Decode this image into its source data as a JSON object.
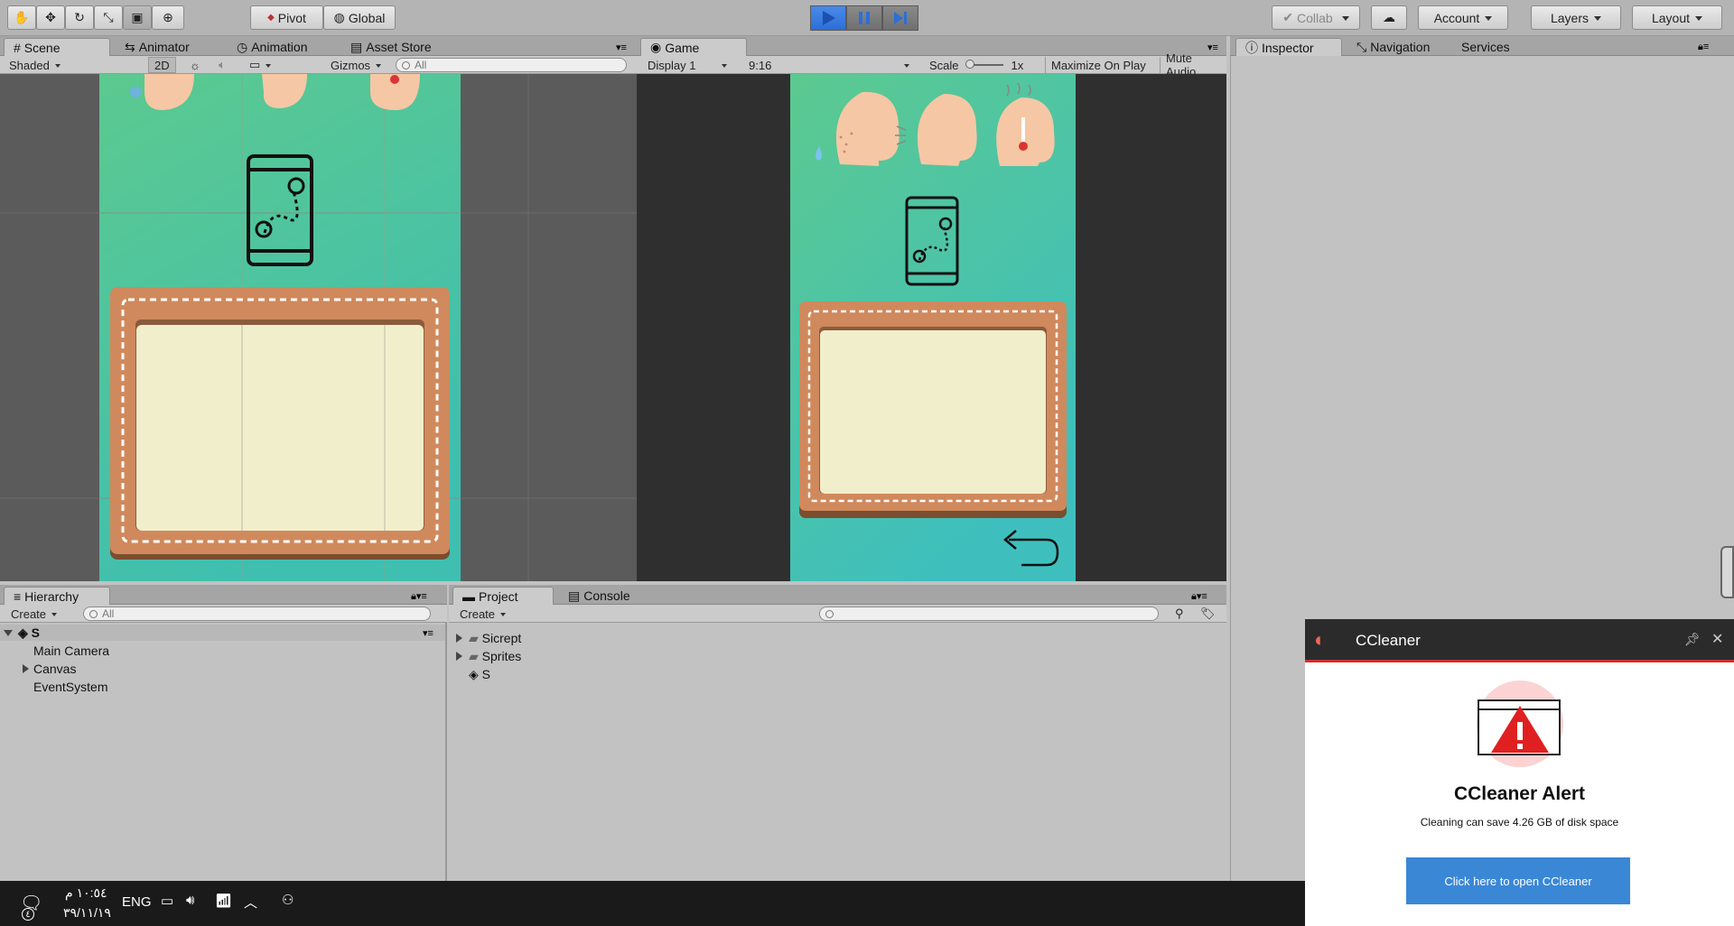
{
  "toolbar": {
    "pivot_label": "Pivot",
    "global_label": "Global",
    "collab_label": "Collab",
    "account_label": "Account",
    "layers_label": "Layers",
    "layout_label": "Layout"
  },
  "scene_panel": {
    "tabs": [
      {
        "label": "Scene"
      },
      {
        "label": "Animator"
      },
      {
        "label": "Animation"
      },
      {
        "label": "Asset Store"
      }
    ],
    "shading_mode": "Shaded",
    "mode_2d": "2D",
    "gizmos_label": "Gizmos",
    "search_placeholder": "All"
  },
  "game_panel": {
    "tab_label": "Game",
    "display_label": "Display 1",
    "aspect_label": "9:16",
    "scale_label": "Scale",
    "scale_value": "1x",
    "maximize_label": "Maximize On Play",
    "mute_label": "Mute Audio"
  },
  "inspector_panel": {
    "tabs": [
      {
        "label": "Inspector"
      },
      {
        "label": "Navigation"
      },
      {
        "label": "Services"
      }
    ]
  },
  "hierarchy": {
    "tab_label": "Hierarchy",
    "create_label": "Create",
    "search_placeholder": "All",
    "scene_name": "S",
    "items": [
      {
        "label": "Main Camera"
      },
      {
        "label": "Canvas"
      },
      {
        "label": "EventSystem"
      }
    ]
  },
  "project": {
    "tab_label": "Project",
    "console_label": "Console",
    "create_label": "Create",
    "items": [
      {
        "label": "Sicrept"
      },
      {
        "label": "Sprites"
      },
      {
        "label": "S"
      }
    ]
  },
  "taskbar": {
    "time": "١٠:٥٤ م",
    "date": "٣٩/١١/١٩",
    "language": "ENG",
    "notification_count": "٤"
  },
  "ccleaner": {
    "app_name": "CCleaner",
    "title": "CCleaner Alert",
    "message": "Cleaning can save 4.26 GB of disk space",
    "button_label": "Click here to open CCleaner",
    "accent_color": "#d32f2f",
    "button_color": "#3a87d6"
  },
  "colors": {
    "play_active": "#2c6fd6",
    "game_background": "#4fc49a"
  }
}
